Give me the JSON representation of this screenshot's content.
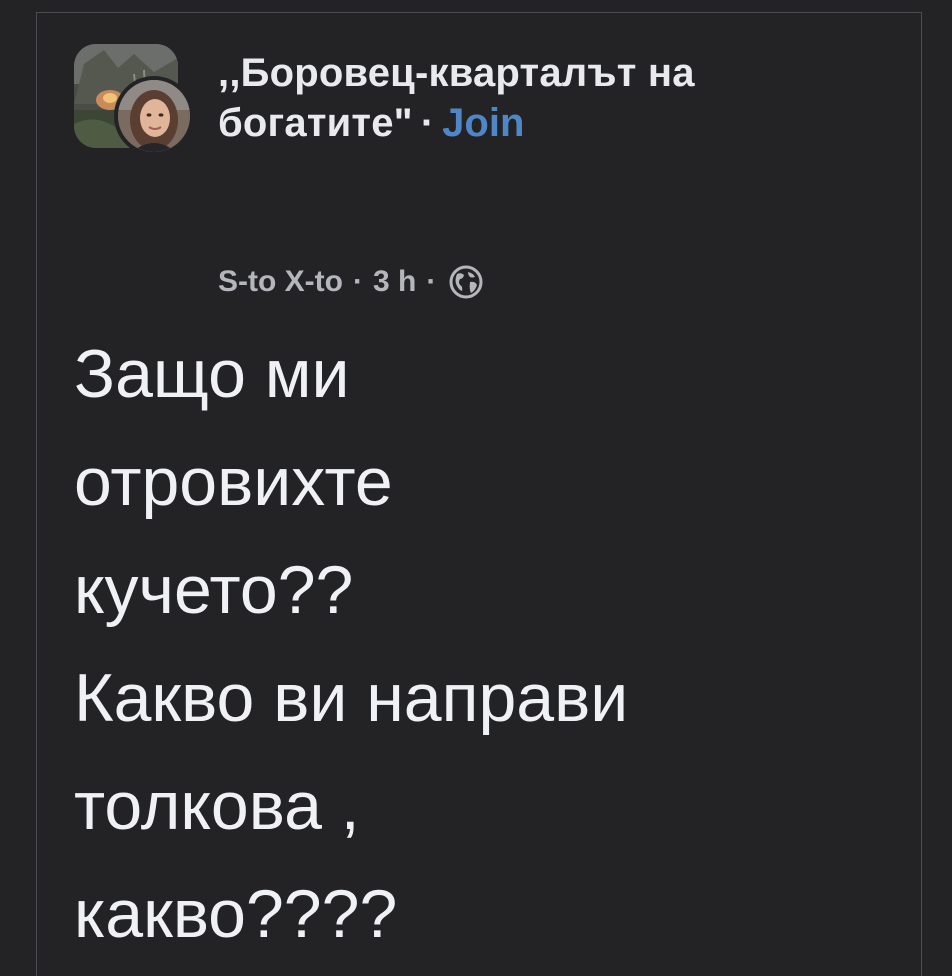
{
  "post": {
    "group_name": ",,Боровец-кварталът на богатите\"",
    "separator": "·",
    "join_label": "Join",
    "author": "S-to X-to",
    "time": "3 h",
    "meta_separator": "·",
    "privacy_icon": "globe-icon",
    "body_lines": [
      "Защо ми",
      "отровихте",
      "кучето??",
      "Какво ви направи",
      "толкова ,",
      "какво????"
    ]
  },
  "colors": {
    "background": "#232325",
    "text": "#f0f1f4",
    "meta": "#b4b6bb",
    "link": "#4f86c6"
  }
}
